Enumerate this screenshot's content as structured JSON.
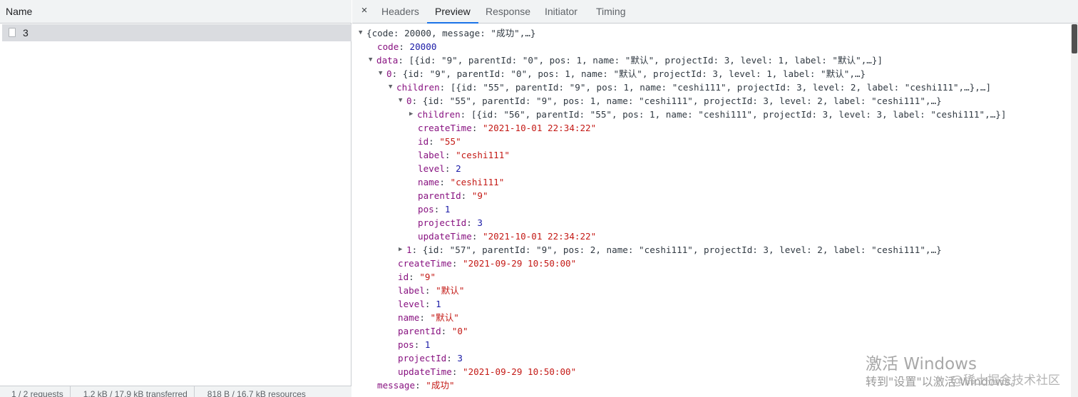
{
  "left": {
    "header_label": "Name",
    "requests": [
      {
        "name": "3"
      }
    ],
    "status": {
      "requests": "1 / 2 requests",
      "transferred": "1.2 kB / 17.9 kB transferred",
      "resources": "818 B / 16.7 kB resources"
    }
  },
  "tabs": {
    "close_glyph": "×",
    "items": [
      "Headers",
      "Preview",
      "Response",
      "Initiator",
      "Timing"
    ],
    "active": "Preview"
  },
  "tree": {
    "root_summary": "{code: 20000, message: \"成功\",…}",
    "code": {
      "key": "code",
      "value": "20000"
    },
    "data": {
      "key": "data",
      "summary": "[{id: \"9\", parentId: \"0\", pos: 1, name: \"默认\", projectId: 3, level: 1, label: \"默认\",…}]",
      "item0": {
        "key": "0",
        "summary": "{id: \"9\", parentId: \"0\", pos: 1, name: \"默认\", projectId: 3, level: 1, label: \"默认\",…}",
        "children": {
          "key": "children",
          "summary": "[{id: \"55\", parentId: \"9\", pos: 1, name: \"ceshi111\", projectId: 3, level: 2, label: \"ceshi111\",…},…]",
          "child0": {
            "key": "0",
            "summary": "{id: \"55\", parentId: \"9\", pos: 1, name: \"ceshi111\", projectId: 3, level: 2, label: \"ceshi111\",…}",
            "children": {
              "key": "children",
              "summary": "[{id: \"56\", parentId: \"55\", pos: 1, name: \"ceshi111\", projectId: 3, level: 3, label: \"ceshi111\",…}]"
            },
            "fields": [
              {
                "key": "createTime",
                "value": "\"2021-10-01 22:34:22\"",
                "type": "s"
              },
              {
                "key": "id",
                "value": "\"55\"",
                "type": "s"
              },
              {
                "key": "label",
                "value": "\"ceshi111\"",
                "type": "s"
              },
              {
                "key": "level",
                "value": "2",
                "type": "n"
              },
              {
                "key": "name",
                "value": "\"ceshi111\"",
                "type": "s"
              },
              {
                "key": "parentId",
                "value": "\"9\"",
                "type": "s"
              },
              {
                "key": "pos",
                "value": "1",
                "type": "n"
              },
              {
                "key": "projectId",
                "value": "3",
                "type": "n"
              },
              {
                "key": "updateTime",
                "value": "\"2021-10-01 22:34:22\"",
                "type": "s"
              }
            ]
          },
          "child1": {
            "key": "1",
            "summary": "{id: \"57\", parentId: \"9\", pos: 2, name: \"ceshi111\", projectId: 3, level: 2, label: \"ceshi111\",…}"
          }
        },
        "fields": [
          {
            "key": "createTime",
            "value": "\"2021-09-29 10:50:00\"",
            "type": "s"
          },
          {
            "key": "id",
            "value": "\"9\"",
            "type": "s"
          },
          {
            "key": "label",
            "value": "\"默认\"",
            "type": "s"
          },
          {
            "key": "level",
            "value": "1",
            "type": "n"
          },
          {
            "key": "name",
            "value": "\"默认\"",
            "type": "s"
          },
          {
            "key": "parentId",
            "value": "\"0\"",
            "type": "s"
          },
          {
            "key": "pos",
            "value": "1",
            "type": "n"
          },
          {
            "key": "projectId",
            "value": "3",
            "type": "n"
          },
          {
            "key": "updateTime",
            "value": "\"2021-09-29 10:50:00\"",
            "type": "s"
          }
        ]
      }
    },
    "message": {
      "key": "message",
      "value": "\"成功\""
    }
  },
  "watermark": {
    "activate_title": "激活 Windows",
    "activate_sub": "转到\"设置\"以激活 Windows。",
    "site": "@稀土掘金技术社区"
  },
  "colors": {
    "key": "#881280",
    "string": "#c41a16",
    "number": "#1a1aa6",
    "active_tab_underline": "#1a73e8",
    "selected_row": "#dadce0"
  }
}
